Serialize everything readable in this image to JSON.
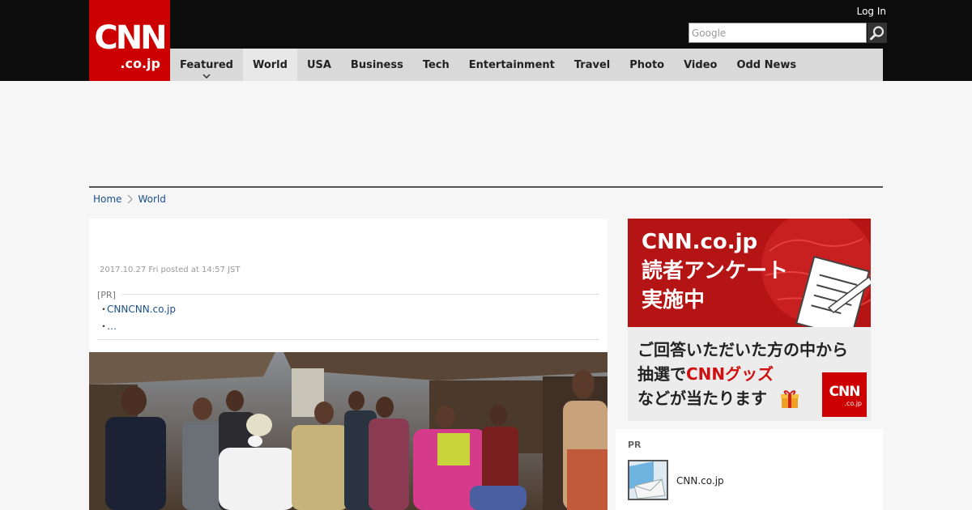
{
  "header": {
    "logo": {
      "main": "CNN",
      "sub": ".co.jp"
    },
    "login_label": "Log In",
    "search": {
      "placeholder": "Google",
      "button_icon": "search-icon"
    }
  },
  "nav": {
    "items": [
      {
        "label": "Featured",
        "has_dropdown": true
      },
      {
        "label": "World",
        "active": true
      },
      {
        "label": "USA"
      },
      {
        "label": "Business"
      },
      {
        "label": "Tech"
      },
      {
        "label": "Entertainment"
      },
      {
        "label": "Travel"
      },
      {
        "label": "Photo"
      },
      {
        "label": "Video"
      },
      {
        "label": "Odd News"
      }
    ]
  },
  "breadcrumb": {
    "home": "Home",
    "current": "World"
  },
  "article": {
    "timestamp": "2017.10.27 Fri posted at 14:57 JST",
    "pr": {
      "label": "[PR]",
      "links": [
        {
          "bullet": "・",
          "text": "CNNCNN.co.jp"
        },
        {
          "bullet": "・",
          "text": "…"
        }
      ]
    }
  },
  "sidebar": {
    "banner": {
      "top_lines": [
        "CNN.co.jp",
        "読者アンケート",
        "実施中"
      ],
      "bottom_line1": "ご回答いただいた方の中から",
      "bottom_line2_prefix": "抽選で",
      "bottom_line2_highlight": "CNNグッズ",
      "bottom_line3": "などが当たります",
      "logo_main": "CNN",
      "logo_sub": ".co.jp"
    },
    "pr_box": {
      "label": "PR",
      "item_text": "CNN.co.jp"
    }
  },
  "colors": {
    "header_bg": "#0c0c0c",
    "brand_red": "#cc0000",
    "nav_bg": "#d9d9d9",
    "link": "#1a4e8a",
    "page_bg": "#f6f6f6"
  }
}
